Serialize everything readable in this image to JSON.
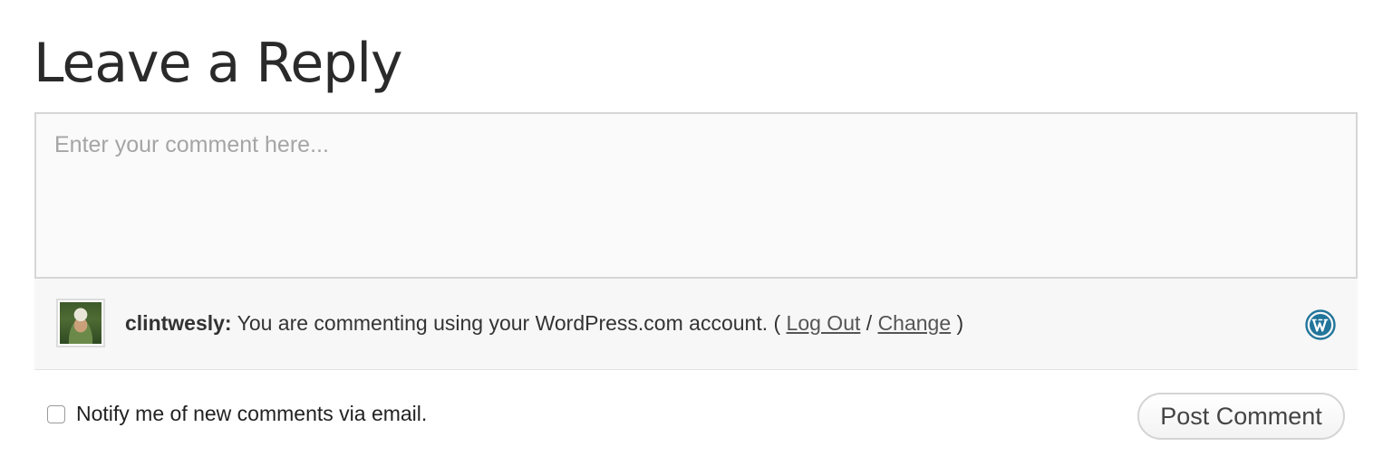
{
  "page": {
    "title": "Leave a Reply"
  },
  "comment": {
    "placeholder": "Enter your comment here...",
    "value": ""
  },
  "identity": {
    "username": "clintwesly:",
    "message": " You are commenting using your WordPress.com account. ( ",
    "logout_label": "Log Out",
    "separator": " / ",
    "change_label": "Change",
    "closing": " )",
    "service_icon": "wordpress-logo-icon"
  },
  "notify": {
    "label": "Notify me of new comments via email.",
    "checked": false
  },
  "actions": {
    "post_label": "Post Comment"
  },
  "colors": {
    "wordpress_blue": "#21759b"
  }
}
